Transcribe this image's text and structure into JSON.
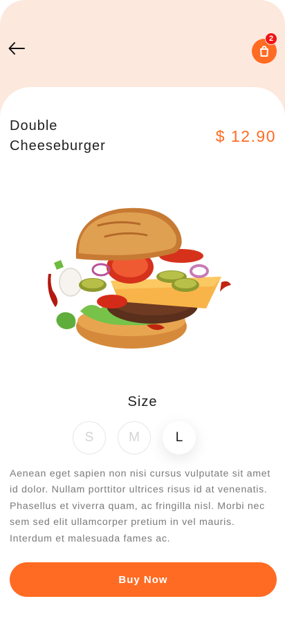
{
  "header": {
    "back_icon": "arrow-left-icon",
    "cart_icon": "shopping-bag-icon",
    "cart_count": "2",
    "accent_color": "#ff6b23",
    "background_color": "#fde8de"
  },
  "product": {
    "name": "Double Cheeseburger",
    "price": "$ 12.90",
    "image": "burger-image"
  },
  "size": {
    "title": "Size",
    "options": [
      "S",
      "M",
      "L"
    ],
    "selected": "L"
  },
  "description": "Aenean eget sapien non nisi cursus vulputate sit amet id dolor. Nullam porttitor ultrices risus id at venenatis. Phasellus et viverra quam, ac fringilla nisl. Morbi nec sem sed elit ullamcorper pretium in vel mauris. Interdum et malesuada fames ac.",
  "actions": {
    "buy_label": "Buy Now"
  }
}
